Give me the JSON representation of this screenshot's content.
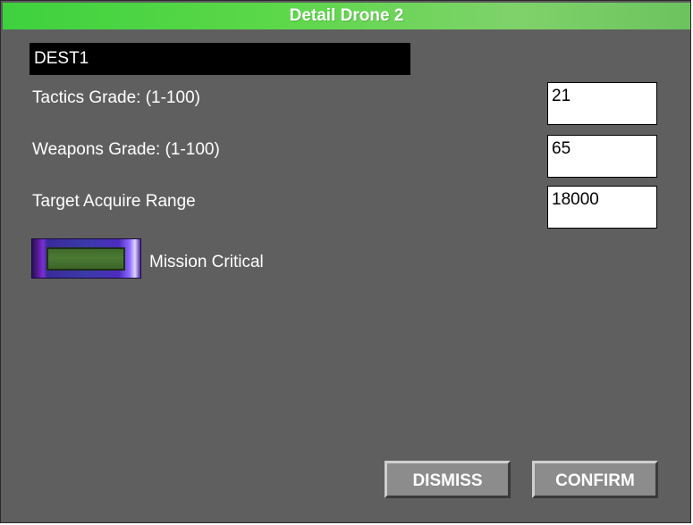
{
  "window": {
    "title": "Detail Drone 2"
  },
  "drone": {
    "name": "DEST1"
  },
  "fields": [
    {
      "label": "Tactics Grade: (1-100)",
      "value": "21"
    },
    {
      "label": "Weapons Grade: (1-100)",
      "value": "65"
    },
    {
      "label": "Target Acquire Range",
      "value": "18000"
    }
  ],
  "mission_critical": {
    "label": "Mission Critical",
    "checked": false,
    "on_color": "#4b7a35",
    "frame_color": "#5a2bc4"
  },
  "buttons": {
    "dismiss_label": "DISMISS",
    "confirm_label": "CONFIRM"
  },
  "colors": {
    "title_bar": "#4fd64a",
    "background": "#5f5f5f",
    "button_face": "#8c8c8c"
  }
}
